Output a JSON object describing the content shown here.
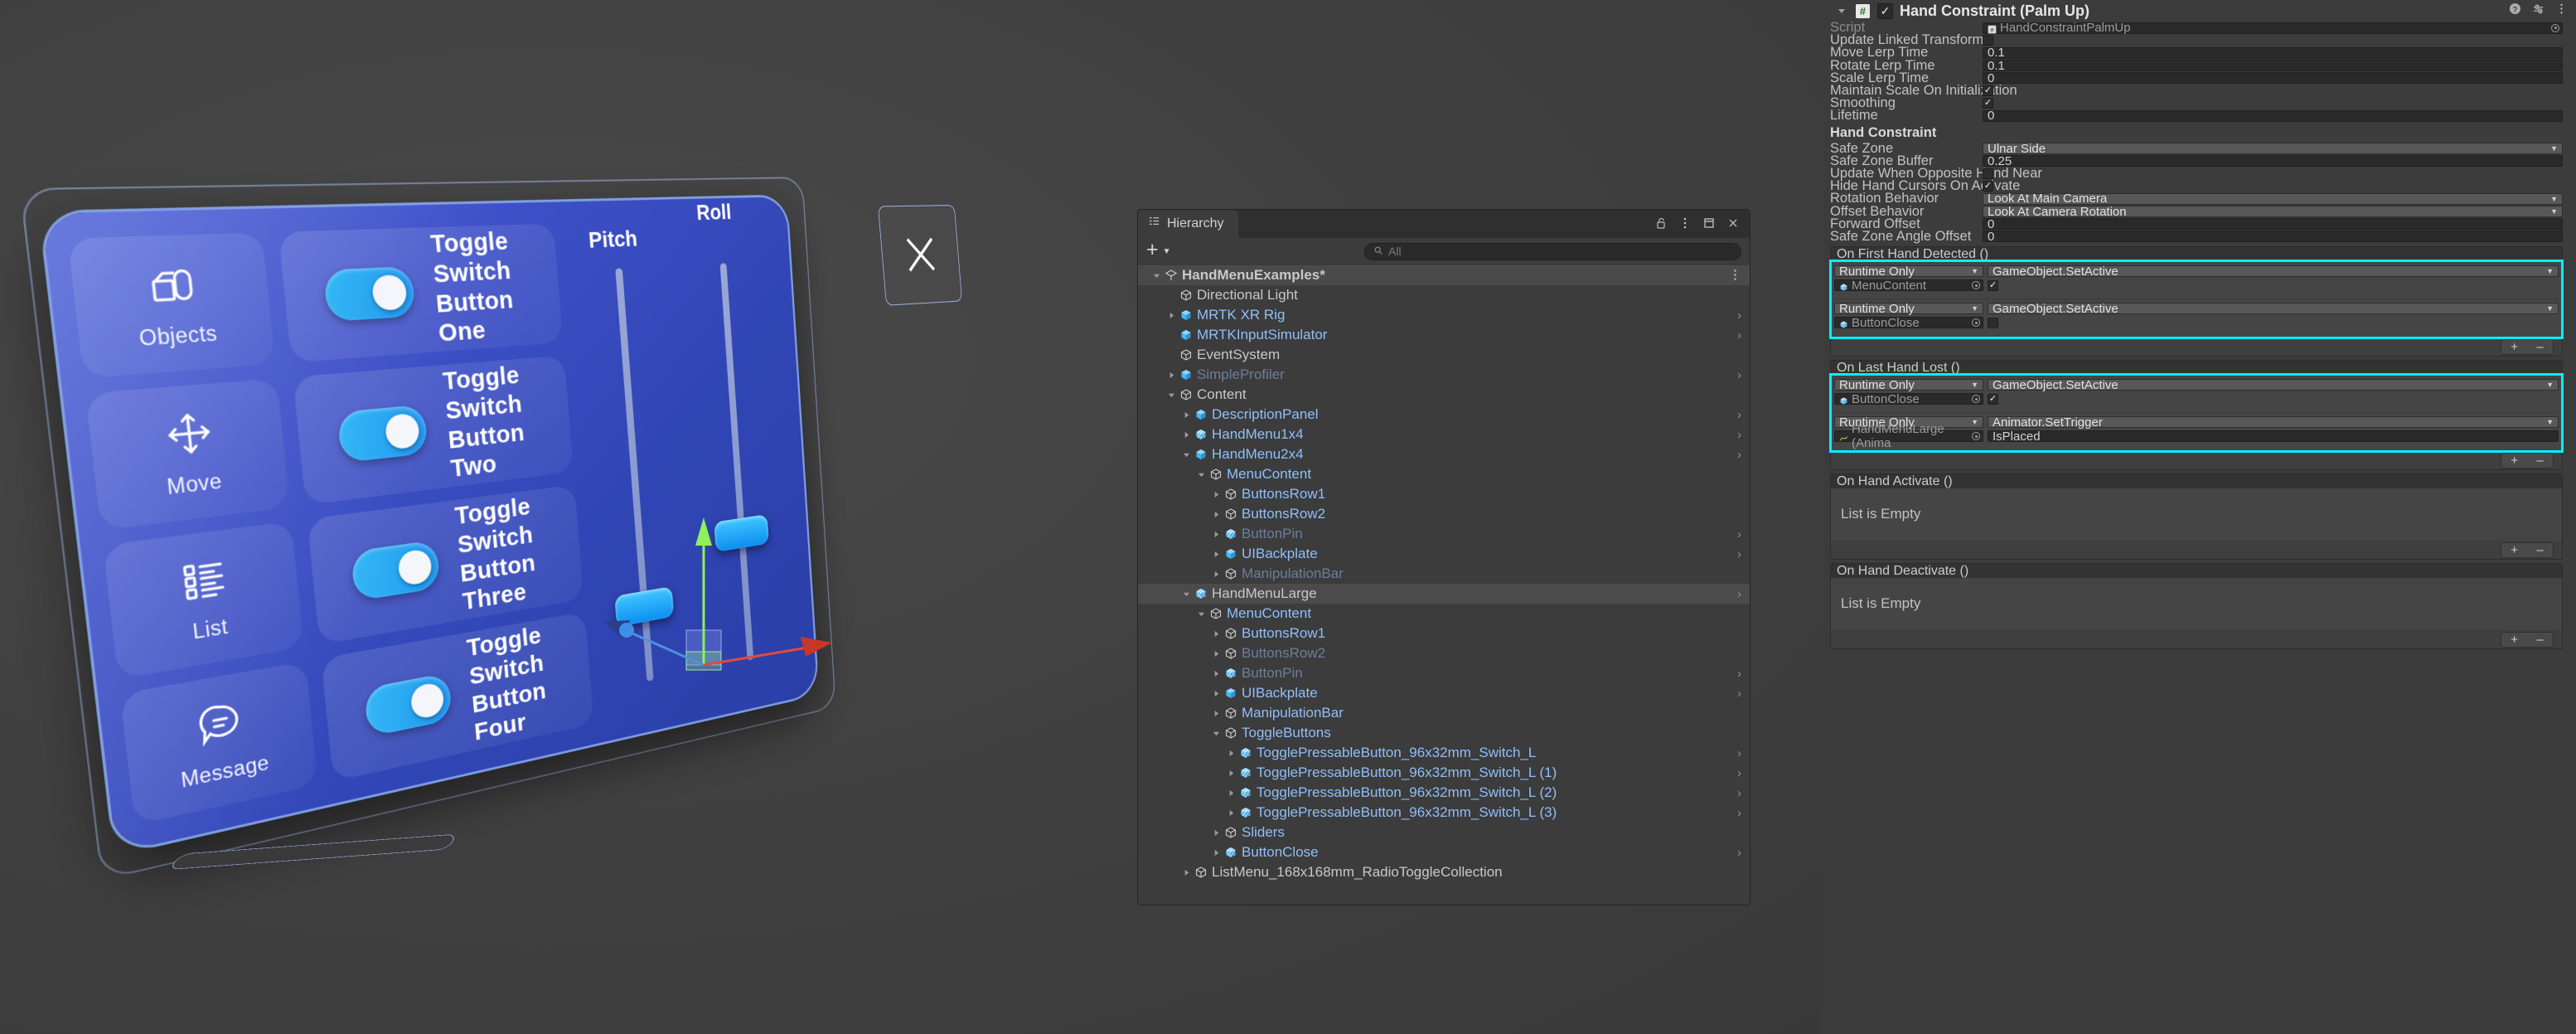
{
  "scene": {
    "rail_items": [
      {
        "label": "Objects",
        "icon": "objects-icon"
      },
      {
        "label": "Move",
        "icon": "move-icon"
      },
      {
        "label": "List",
        "icon": "list-icon"
      },
      {
        "label": "Message",
        "icon": "message-icon"
      }
    ],
    "toggles": [
      {
        "line1": "Toggle Switch",
        "line2": "Button One",
        "on": true
      },
      {
        "line1": "Toggle Switch",
        "line2": "Button Two",
        "on": true
      },
      {
        "line1": "Toggle Switch",
        "line2": "Button Three",
        "on": true
      },
      {
        "line1": "Toggle Switch",
        "line2": "Button Four",
        "on": true
      }
    ],
    "sliders": [
      {
        "label": "Pitch"
      },
      {
        "label": "Roll"
      }
    ],
    "close_button_icon": "close-x-icon"
  },
  "hierarchy": {
    "tab_label": "Hierarchy",
    "tab_icon": "hierarchy-icon",
    "tools": [
      "lock-icon",
      "kebab-menu-icon",
      "maximize-icon",
      "close-icon"
    ],
    "add_label": "+",
    "search_placeholder": "All",
    "search_value": "",
    "rows": [
      {
        "depth": 0,
        "label": "HandMenuExamples*",
        "icon": "unity-scene-icon",
        "tone": "scene",
        "twirl": "down",
        "kebab": true
      },
      {
        "depth": 1,
        "label": "Directional Light",
        "icon": "gameobject-icon",
        "tone": "plain",
        "twirl": "none"
      },
      {
        "depth": 1,
        "label": "MRTK XR Rig",
        "icon": "prefab-icon",
        "tone": "prefab",
        "twirl": "right",
        "chev": true
      },
      {
        "depth": 1,
        "label": "MRTKInputSimulator",
        "icon": "prefab-icon",
        "tone": "prefab",
        "twirl": "none",
        "chev": true
      },
      {
        "depth": 1,
        "label": "EventSystem",
        "icon": "gameobject-icon",
        "tone": "plain",
        "twirl": "none"
      },
      {
        "depth": 1,
        "label": "SimpleProfiler",
        "icon": "prefab-icon",
        "tone": "dim",
        "twirl": "right",
        "chev": true
      },
      {
        "depth": 1,
        "label": "Content",
        "icon": "gameobject-icon",
        "tone": "plain",
        "twirl": "down"
      },
      {
        "depth": 2,
        "label": "DescriptionPanel",
        "icon": "prefab-icon",
        "tone": "prefab",
        "twirl": "right",
        "chev": true
      },
      {
        "depth": 2,
        "label": "HandMenu1x4",
        "icon": "prefab-variant-icon",
        "tone": "prefab",
        "twirl": "right",
        "chev": true
      },
      {
        "depth": 2,
        "label": "HandMenu2x4",
        "icon": "prefab-icon",
        "tone": "prefab",
        "twirl": "down",
        "chev": true
      },
      {
        "depth": 3,
        "label": "MenuContent",
        "icon": "gameobject-icon",
        "tone": "prefab",
        "twirl": "down"
      },
      {
        "depth": 4,
        "label": "ButtonsRow1",
        "icon": "gameobject-icon",
        "tone": "prefab",
        "twirl": "right"
      },
      {
        "depth": 4,
        "label": "ButtonsRow2",
        "icon": "gameobject-icon",
        "tone": "prefab",
        "twirl": "right"
      },
      {
        "depth": 4,
        "label": "ButtonPin",
        "icon": "prefab-variant-icon",
        "tone": "dim",
        "twirl": "right",
        "chev": true
      },
      {
        "depth": 4,
        "label": "UIBackplate",
        "icon": "prefab-icon",
        "tone": "prefab",
        "twirl": "right",
        "chev": true
      },
      {
        "depth": 4,
        "label": "ManipulationBar",
        "icon": "gameobject-icon",
        "tone": "dim",
        "twirl": "right"
      },
      {
        "depth": 2,
        "label": "HandMenuLarge",
        "icon": "prefab-variant-icon",
        "tone": "selected",
        "twirl": "down",
        "chev": true,
        "selected": true
      },
      {
        "depth": 3,
        "label": "MenuContent",
        "icon": "gameobject-icon",
        "tone": "prefab",
        "twirl": "down"
      },
      {
        "depth": 4,
        "label": "ButtonsRow1",
        "icon": "gameobject-icon",
        "tone": "prefab",
        "twirl": "right"
      },
      {
        "depth": 4,
        "label": "ButtonsRow2",
        "icon": "gameobject-icon",
        "tone": "dim",
        "twirl": "right"
      },
      {
        "depth": 4,
        "label": "ButtonPin",
        "icon": "prefab-variant-icon",
        "tone": "dim",
        "twirl": "right",
        "chev": true
      },
      {
        "depth": 4,
        "label": "UIBackplate",
        "icon": "prefab-icon",
        "tone": "prefab",
        "twirl": "right",
        "chev": true
      },
      {
        "depth": 4,
        "label": "ManipulationBar",
        "icon": "gameobject-icon",
        "tone": "prefab",
        "twirl": "right"
      },
      {
        "depth": 4,
        "label": "ToggleButtons",
        "icon": "gameobject-icon",
        "tone": "prefab",
        "twirl": "down"
      },
      {
        "depth": 5,
        "label": "TogglePressableButton_96x32mm_Switch_L",
        "icon": "prefab-variant-icon",
        "tone": "prefab",
        "twirl": "right",
        "chev": true
      },
      {
        "depth": 5,
        "label": "TogglePressableButton_96x32mm_Switch_L (1)",
        "icon": "prefab-variant-icon",
        "tone": "prefab",
        "twirl": "right",
        "chev": true
      },
      {
        "depth": 5,
        "label": "TogglePressableButton_96x32mm_Switch_L (2)",
        "icon": "prefab-variant-icon",
        "tone": "prefab",
        "twirl": "right",
        "chev": true
      },
      {
        "depth": 5,
        "label": "TogglePressableButton_96x32mm_Switch_L (3)",
        "icon": "prefab-variant-icon",
        "tone": "prefab",
        "twirl": "right",
        "chev": true
      },
      {
        "depth": 4,
        "label": "Sliders",
        "icon": "gameobject-icon",
        "tone": "prefab",
        "twirl": "right"
      },
      {
        "depth": 4,
        "label": "ButtonClose",
        "icon": "prefab-variant-icon",
        "tone": "prefab",
        "twirl": "right",
        "chev": true
      },
      {
        "depth": 2,
        "label": "ListMenu_168x168mm_RadioToggleCollection",
        "icon": "gameobject-icon",
        "tone": "plain",
        "twirl": "right"
      }
    ]
  },
  "inspector": {
    "component_title": "Hand Constraint (Palm Up)",
    "component_enabled": true,
    "component_icon": "script-icon",
    "header_tools": [
      "help-icon",
      "preset-icon",
      "kebab-menu-icon"
    ],
    "properties": [
      {
        "label": "Script",
        "dim": true,
        "type": "object",
        "value": "HandConstraintPalmUp"
      },
      {
        "label": "Update Linked Transform",
        "type": "checkbox",
        "checked": false
      },
      {
        "label": "Move Lerp Time",
        "type": "text",
        "value": "0.1"
      },
      {
        "label": "Rotate Lerp Time",
        "type": "text",
        "value": "0.1"
      },
      {
        "label": "Scale Lerp Time",
        "type": "text",
        "value": "0"
      },
      {
        "label": "Maintain Scale On Initialization",
        "type": "checkbox",
        "checked": true
      },
      {
        "label": "Smoothing",
        "type": "checkbox",
        "checked": true
      },
      {
        "label": "Lifetime",
        "type": "text",
        "value": "0"
      }
    ],
    "section_title": "Hand Constraint",
    "properties2": [
      {
        "label": "Safe Zone",
        "type": "dropdown",
        "value": "Ulnar Side"
      },
      {
        "label": "Safe Zone Buffer",
        "type": "text",
        "value": "0.25"
      },
      {
        "label": "Update When Opposite Hand Near",
        "type": "checkbox",
        "checked": false
      },
      {
        "label": "Hide Hand Cursors On Activate",
        "type": "checkbox",
        "checked": true
      },
      {
        "label": "Rotation Behavior",
        "type": "dropdown",
        "value": "Look At Main Camera"
      },
      {
        "label": "Offset Behavior",
        "type": "dropdown",
        "value": "Look At Camera Rotation"
      },
      {
        "label": "Forward Offset",
        "type": "text",
        "value": "0"
      },
      {
        "label": "Safe Zone Angle Offset",
        "type": "text",
        "value": "0"
      }
    ],
    "events": [
      {
        "title": "On First Hand Detected ()",
        "highlighted": true,
        "empty_label": null,
        "entries": [
          {
            "mode": "Runtime Only",
            "function": "GameObject.SetActive",
            "target": "MenuContent",
            "arg_type": "checkbox",
            "arg_checked": true
          },
          {
            "mode": "Runtime Only",
            "function": "GameObject.SetActive",
            "target": "ButtonClose",
            "arg_type": "checkbox",
            "arg_checked": false
          }
        ],
        "add_label": "+",
        "remove_label": "–"
      },
      {
        "title": "On Last Hand Lost ()",
        "highlighted": true,
        "empty_label": null,
        "entries": [
          {
            "mode": "Runtime Only",
            "function": "GameObject.SetActive",
            "target": "ButtonClose",
            "arg_type": "checkbox",
            "arg_checked": true
          },
          {
            "mode": "Runtime Only",
            "function": "Animator.SetTrigger",
            "target": "HandMenuLarge (Anima",
            "target_icon": "animator-icon",
            "arg_type": "text",
            "arg_value": "IsPlaced"
          }
        ],
        "add_label": "+",
        "remove_label": "–"
      },
      {
        "title": "On Hand Activate ()",
        "highlighted": false,
        "empty_label": "List is Empty",
        "entries": [],
        "add_label": "+",
        "remove_label": "–"
      },
      {
        "title": "On Hand Deactivate ()",
        "highlighted": false,
        "empty_label": "List is Empty",
        "entries": [],
        "add_label": "+",
        "remove_label": "–"
      }
    ]
  },
  "colors": {
    "highlight": "#00f0ff",
    "panel_bg": "#3c3c3c",
    "prefab_blue": "#8fbffb",
    "menu_blue": "#3f51c9",
    "toggle_on": "#22a3f0"
  }
}
